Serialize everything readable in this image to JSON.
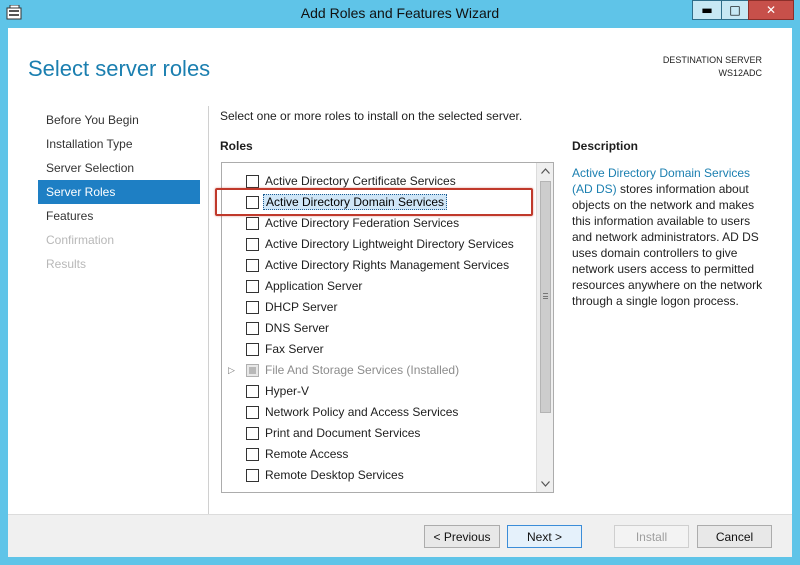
{
  "window": {
    "title": "Add Roles and Features Wizard",
    "minimize": "▬",
    "maximize": "□",
    "close": "✕"
  },
  "header": {
    "page_title": "Select server roles",
    "destination_label": "DESTINATION SERVER",
    "destination_value": "WS12ADC"
  },
  "nav": {
    "items": [
      {
        "label": "Before You Begin",
        "state": "normal"
      },
      {
        "label": "Installation Type",
        "state": "normal"
      },
      {
        "label": "Server Selection",
        "state": "normal"
      },
      {
        "label": "Server Roles",
        "state": "active"
      },
      {
        "label": "Features",
        "state": "normal"
      },
      {
        "label": "Confirmation",
        "state": "disabled"
      },
      {
        "label": "Results",
        "state": "disabled"
      }
    ]
  },
  "main": {
    "instruction": "Select one or more roles to install on the selected server.",
    "roles_heading": "Roles",
    "roles": [
      {
        "label": "Active Directory Certificate Services"
      },
      {
        "label": "Active Directory Domain Services"
      },
      {
        "label": "Active Directory Federation Services"
      },
      {
        "label": "Active Directory Lightweight Directory Services"
      },
      {
        "label": "Active Directory Rights Management Services"
      },
      {
        "label": "Application Server"
      },
      {
        "label": "DHCP Server"
      },
      {
        "label": "DNS Server"
      },
      {
        "label": "Fax Server"
      },
      {
        "label": "File And Storage Services (Installed)"
      },
      {
        "label": "Hyper-V"
      },
      {
        "label": "Network Policy and Access Services"
      },
      {
        "label": "Print and Document Services"
      },
      {
        "label": "Remote Access"
      },
      {
        "label": "Remote Desktop Services"
      }
    ],
    "expander_glyph": "▷"
  },
  "description": {
    "heading": "Description",
    "accent_text": "Active Directory Domain Services (AD DS)",
    "body_text": " stores information about objects on the network and makes this information available to users and network administrators. AD DS uses domain controllers to give network users access to permitted resources anywhere on the network through a single logon process."
  },
  "footer": {
    "previous": "< Previous",
    "next": "Next >",
    "install": "Install",
    "cancel": "Cancel"
  },
  "colors": {
    "accent": "#1b7fb0",
    "nav_active": "#1e7fc4",
    "titlebar": "#5fc4e8",
    "highlight_frame": "#c0392b"
  }
}
